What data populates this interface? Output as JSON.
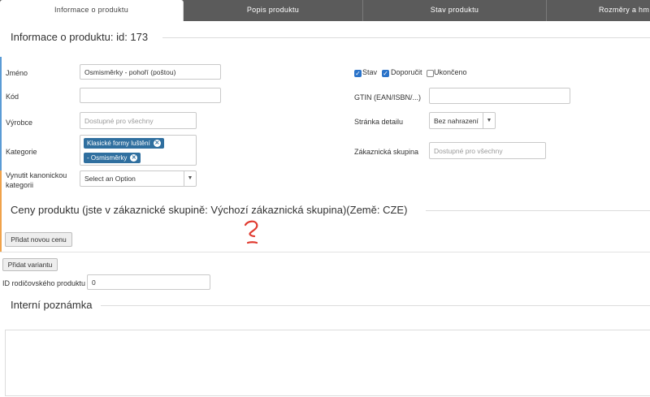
{
  "tabs": [
    {
      "label": "Informace o produktu",
      "active": true
    },
    {
      "label": "Popis produktu",
      "active": false
    },
    {
      "label": "Stav produktu",
      "active": false
    },
    {
      "label": "Rozměry a hm",
      "active": false
    }
  ],
  "product_info": {
    "legend": "Informace o produktu: id: 173",
    "name_label": "Jméno",
    "name_value": "Osmisměrky - pohoří (poštou)",
    "code_label": "Kód",
    "code_value": "",
    "manufacturer_label": "Výrobce",
    "manufacturer_placeholder": "Dostupné pro všechny",
    "category_label": "Kategorie",
    "category_tags": [
      "Klasické formy luštění",
      "- Osmisměrky"
    ],
    "canonical_label_line1": "Vynutit kanonickou",
    "canonical_label_line2": "kategorii",
    "canonical_select": "Select an Option",
    "status_checks": [
      {
        "label": "Stav",
        "checked": true
      },
      {
        "label": "Doporučit",
        "checked": true
      },
      {
        "label": "Ukončeno",
        "checked": false
      }
    ],
    "gtin_label": "GTIN (EAN/ISBN/...)",
    "gtin_value": "",
    "detail_page_label": "Stránka detailu",
    "detail_page_select": "Bez nahrazení",
    "customer_group_label": "Zákaznická skupina",
    "customer_group_placeholder": "Dostupné pro všechny"
  },
  "prices": {
    "legend": "Ceny produktu (jste v zákaznické skupině: Výchozí zákaznická skupina)(Země: CZE)",
    "add_price_button": "Přidat novou cenu",
    "annotation": "?",
    "annotation_color": "#e03a2f"
  },
  "variants": {
    "add_variant_button": "Přidat variantu",
    "parent_id_label": "ID rodičovského produktu",
    "parent_id_value": "0"
  },
  "note": {
    "legend": "Interní poznámka",
    "value": ""
  },
  "colors": {
    "tab_bar": "#5b5b5b",
    "tag": "#2f6f9f",
    "accent_blue": "#5a9bd5",
    "accent_orange": "#f0a24a",
    "checkbox": "#2a73c9"
  }
}
